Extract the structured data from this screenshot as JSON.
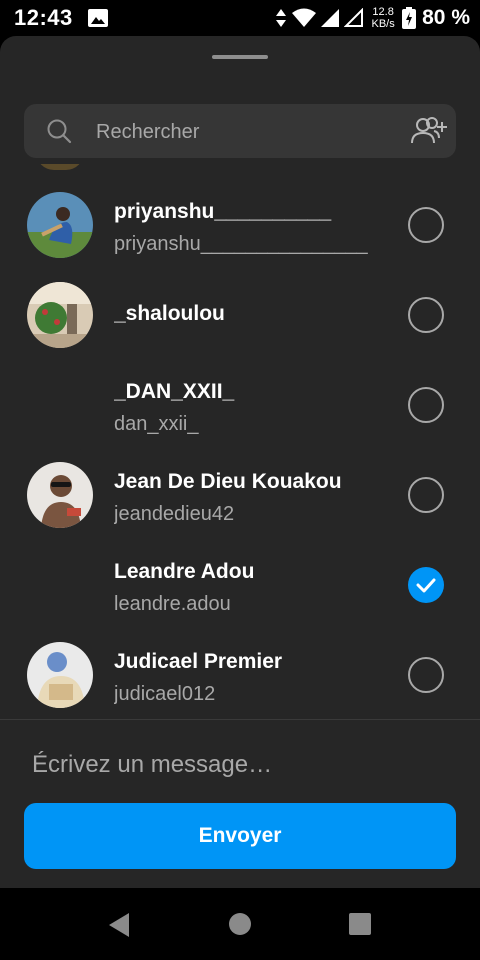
{
  "status_bar": {
    "time": "12:43",
    "network_speed_value": "12.8",
    "network_speed_unit": "KB/s",
    "battery_percent": "80 %"
  },
  "search": {
    "placeholder": "Rechercher"
  },
  "contacts": [
    {
      "name": "priyanshu__________",
      "username": "priyanshu_______________",
      "has_avatar": true,
      "selected": false
    },
    {
      "name": "_shaloulou",
      "username": "",
      "has_avatar": true,
      "selected": false
    },
    {
      "name": "_DAN_XXII_",
      "username": "dan_xxii_",
      "has_avatar": false,
      "selected": false
    },
    {
      "name": "Jean De Dieu Kouakou",
      "username": "jeandedieu42",
      "has_avatar": true,
      "selected": false
    },
    {
      "name": "Leandre Adou",
      "username": "leandre.adou",
      "has_avatar": false,
      "selected": true
    },
    {
      "name": "Judicael Premier",
      "username": "judicael012",
      "has_avatar": true,
      "selected": false
    }
  ],
  "composer": {
    "message_placeholder": "Écrivez un message…",
    "send_label": "Envoyer"
  },
  "colors": {
    "accent": "#0095f6",
    "sheet_background": "#262626",
    "search_background": "#363636",
    "secondary_text": "#a8a8a8"
  },
  "icons": [
    "gallery-icon",
    "wifi-icon",
    "signal-icon",
    "battery-icon",
    "search-icon",
    "add-people-icon",
    "checkmark-icon",
    "nav-back-icon",
    "nav-home-icon",
    "nav-recents-icon"
  ]
}
